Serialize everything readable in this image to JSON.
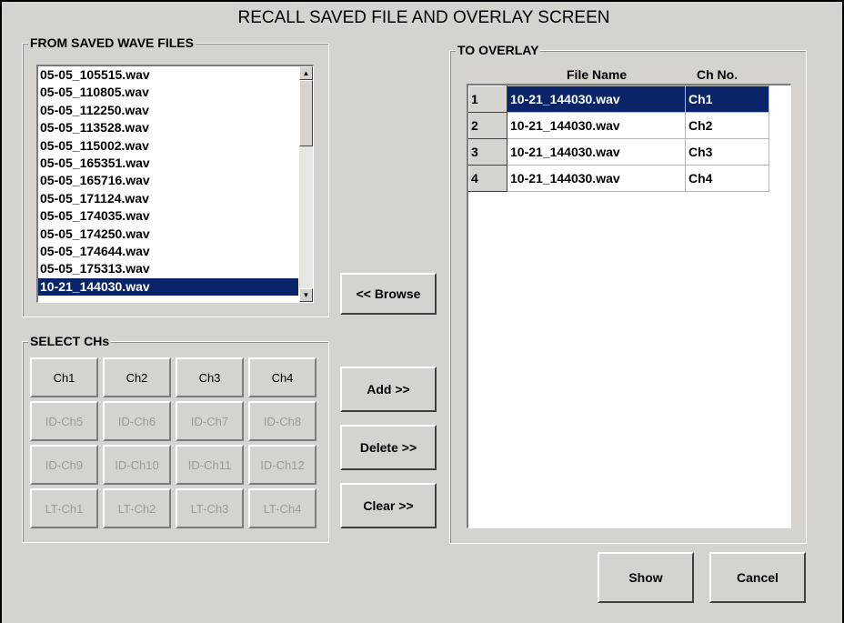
{
  "title": "RECALL SAVED FILE AND OVERLAY SCREEN",
  "saved_files": {
    "legend": "FROM SAVED WAVE FILES",
    "items": [
      {
        "label": "05-05_105515.wav"
      },
      {
        "label": "05-05_110805.wav"
      },
      {
        "label": "05-05_112250.wav"
      },
      {
        "label": "05-05_113528.wav"
      },
      {
        "label": "05-05_115002.wav"
      },
      {
        "label": "05-05_165351.wav"
      },
      {
        "label": "05-05_165716.wav"
      },
      {
        "label": "05-05_171124.wav"
      },
      {
        "label": "05-05_174035.wav"
      },
      {
        "label": "05-05_174250.wav"
      },
      {
        "label": "05-05_174644.wav"
      },
      {
        "label": "05-05_175313.wav"
      },
      {
        "label": "10-21_144030.wav",
        "selected": true
      }
    ]
  },
  "select_chs": {
    "legend": "SELECT CHs",
    "buttons": [
      {
        "label": "Ch1",
        "enabled": true
      },
      {
        "label": "Ch2",
        "enabled": true
      },
      {
        "label": "Ch3",
        "enabled": true
      },
      {
        "label": "Ch4",
        "enabled": true
      },
      {
        "label": "ID-Ch5",
        "enabled": false
      },
      {
        "label": "ID-Ch6",
        "enabled": false
      },
      {
        "label": "ID-Ch7",
        "enabled": false
      },
      {
        "label": "ID-Ch8",
        "enabled": false
      },
      {
        "label": "ID-Ch9",
        "enabled": false
      },
      {
        "label": "ID-Ch10",
        "enabled": false
      },
      {
        "label": "ID-Ch11",
        "enabled": false
      },
      {
        "label": "ID-Ch12",
        "enabled": false
      },
      {
        "label": "LT-Ch1",
        "enabled": false
      },
      {
        "label": "LT-Ch2",
        "enabled": false
      },
      {
        "label": "LT-Ch3",
        "enabled": false
      },
      {
        "label": "LT-Ch4",
        "enabled": false
      }
    ]
  },
  "actions": {
    "browse": "<< Browse",
    "add": "Add >>",
    "delete": "Delete >>",
    "clear": "Clear >>"
  },
  "overlay": {
    "legend": "TO OVERLAY",
    "col_file": "File Name",
    "col_ch": "Ch No.",
    "rows": [
      {
        "index": "1",
        "file": "10-21_144030.wav",
        "ch": "Ch1",
        "selected": true
      },
      {
        "index": "2",
        "file": "10-21_144030.wav",
        "ch": "Ch2"
      },
      {
        "index": "3",
        "file": "10-21_144030.wav",
        "ch": "Ch3"
      },
      {
        "index": "4",
        "file": "10-21_144030.wav",
        "ch": "Ch4"
      }
    ]
  },
  "footer": {
    "show": "Show",
    "cancel": "Cancel"
  },
  "colors": {
    "window_bg": "#d6d3ce",
    "selection": "#0a246a"
  }
}
